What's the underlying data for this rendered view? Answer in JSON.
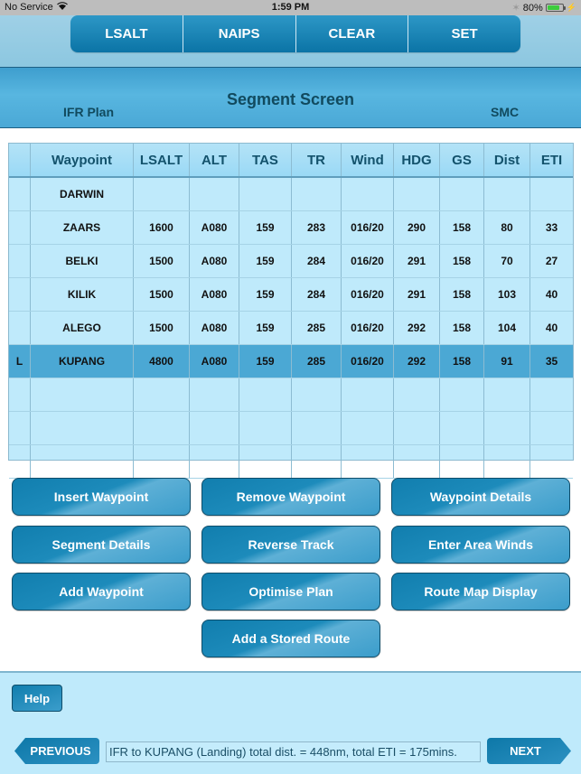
{
  "status_bar": {
    "carrier": "No Service",
    "time": "1:59 PM",
    "battery_percent": "80%",
    "battery_level": 0.8
  },
  "top_segments": [
    "LSALT",
    "NAIPS",
    "CLEAR",
    "SET"
  ],
  "header": {
    "title": "Segment Screen",
    "plan_type": "IFR Plan",
    "code": "SMC"
  },
  "table": {
    "columns": [
      "",
      "Waypoint",
      "LSALT",
      "ALT",
      "TAS",
      "TR",
      "Wind",
      "HDG",
      "GS",
      "Dist",
      "ETI"
    ],
    "rows": [
      [
        "",
        "DARWIN",
        "",
        "",
        "",
        "",
        "",
        "",
        "",
        "",
        ""
      ],
      [
        "",
        "ZAARS",
        "1600",
        "A080",
        "159",
        "283",
        "016/20",
        "290",
        "158",
        "80",
        "33"
      ],
      [
        "",
        "BELKI",
        "1500",
        "A080",
        "159",
        "284",
        "016/20",
        "291",
        "158",
        "70",
        "27"
      ],
      [
        "",
        "KILIK",
        "1500",
        "A080",
        "159",
        "284",
        "016/20",
        "291",
        "158",
        "103",
        "40"
      ],
      [
        "",
        "ALEGO",
        "1500",
        "A080",
        "159",
        "285",
        "016/20",
        "292",
        "158",
        "104",
        "40"
      ],
      [
        "L",
        "KUPANG",
        "4800",
        "A080",
        "159",
        "285",
        "016/20",
        "292",
        "158",
        "91",
        "35"
      ],
      [
        "",
        "",
        "",
        "",
        "",
        "",
        "",
        "",
        "",
        "",
        ""
      ],
      [
        "",
        "",
        "",
        "",
        "",
        "",
        "",
        "",
        "",
        "",
        ""
      ],
      [
        "",
        "",
        "",
        "",
        "",
        "",
        "",
        "",
        "",
        "",
        ""
      ]
    ],
    "selected_row": 5
  },
  "actions": {
    "insert_waypoint": "Insert Waypoint",
    "remove_waypoint": "Remove Waypoint",
    "waypoint_details": "Waypoint Details",
    "segment_details": "Segment Details",
    "reverse_track": "Reverse Track",
    "enter_area_winds": "Enter Area Winds",
    "add_waypoint": "Add Waypoint",
    "optimise_plan": "Optimise Plan",
    "route_map_display": "Route Map Display",
    "add_stored_route": "Add a Stored Route"
  },
  "footer": {
    "help": "Help",
    "previous": "PREVIOUS",
    "next": "NEXT",
    "summary": "IFR to KUPANG (Landing) total dist. = 448nm, total ETI = 175mins."
  }
}
